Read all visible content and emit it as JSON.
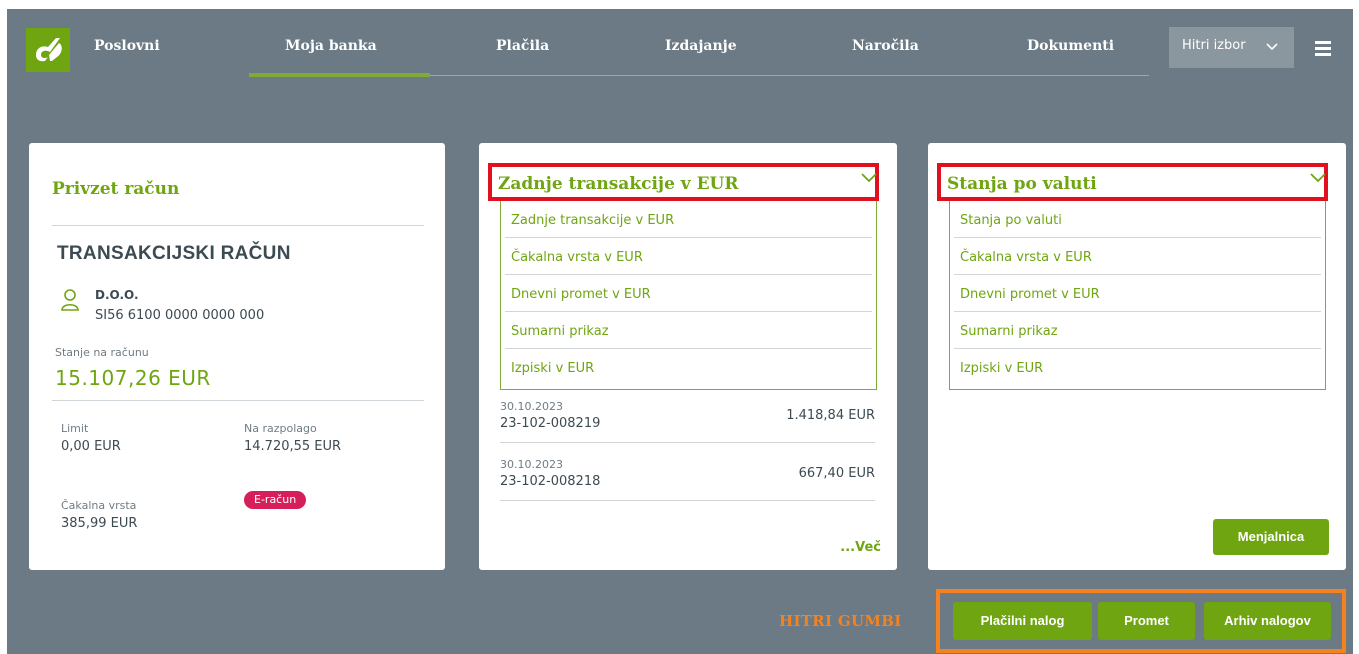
{
  "nav": {
    "brand": "Poslovni",
    "items": [
      {
        "label": "Moja banka",
        "active": true
      },
      {
        "label": "Plačila"
      },
      {
        "label": "Izdajanje"
      },
      {
        "label": "Naročila"
      },
      {
        "label": "Dokumenti"
      }
    ],
    "quick_select": "Hitri izbor",
    "icons": {
      "logo": "bank-logo-icon",
      "menu": "hamburger-menu-icon",
      "chevron": "chevron-down-icon"
    }
  },
  "account_card": {
    "title": "Privzet račun",
    "account_type": "TRANSAKCIJSKI RAČUN",
    "company": "D.O.O.",
    "iban": "SI56 6100 0000 0000 000",
    "balance_label": "Stanje na računu",
    "balance": "15.107,26 EUR",
    "limit_label": "Limit",
    "limit": "0,00 EUR",
    "available_label": "Na razpolago",
    "available": "14.720,55 EUR",
    "queue_label": "Čakalna vrsta",
    "queue": "385,99 EUR",
    "badge": "E-račun"
  },
  "transactions_card": {
    "selected": "Zadnje transakcije v EUR",
    "options": [
      "Zadnje transakcije v EUR",
      "Čakalna vrsta v EUR",
      "Dnevni promet v EUR",
      "Sumarni prikaz",
      "Izpiski v EUR"
    ],
    "transactions": [
      {
        "date": "30.10.2023",
        "ref": "23-102-008219",
        "amount": "1.418,84 EUR"
      },
      {
        "date": "30.10.2023",
        "ref": "23-102-008218",
        "amount": "667,40 EUR"
      }
    ],
    "more": "...Več"
  },
  "currency_card": {
    "selected": "Stanja po valuti",
    "options": [
      "Stanja po valuti",
      "Čakalna vrsta v EUR",
      "Dnevni promet v EUR",
      "Sumarni prikaz",
      "Izpiski v EUR"
    ],
    "button": "Menjalnica"
  },
  "quick_buttons": {
    "label": "HITRI GUMBI",
    "buttons": [
      "Plačilni nalog",
      "Promet",
      "Arhiv nalogov"
    ]
  },
  "colors": {
    "accent": "#6fa511",
    "background": "#6b7a84",
    "highlight_red": "#e0101e",
    "highlight_orange": "#f58220",
    "badge": "#d61f5a"
  }
}
